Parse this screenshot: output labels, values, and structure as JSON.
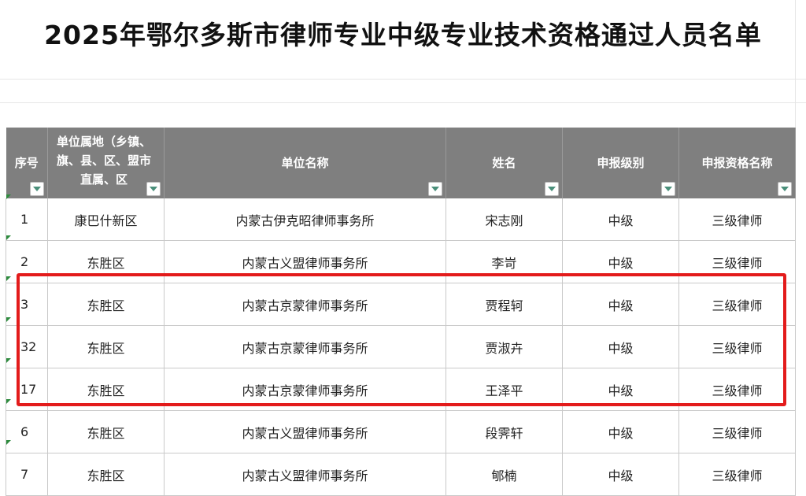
{
  "title": "2025年鄂尔多斯市律师专业中级专业技术资格通过人员名单",
  "table": {
    "headers": [
      {
        "label": "序号"
      },
      {
        "label": "单位属地（乡镇、旗、县、区、盟市直属、区"
      },
      {
        "label": "单位名称"
      },
      {
        "label": "姓名"
      },
      {
        "label": "申报级别"
      },
      {
        "label": "申报资格名称"
      }
    ],
    "rows": [
      {
        "no": "1",
        "region": "康巴什新区",
        "unit": "内蒙古伊克昭律师事务所",
        "name": "宋志刚",
        "level": "中级",
        "qual": "三级律师"
      },
      {
        "no": "2",
        "region": "东胜区",
        "unit": "内蒙古义盟律师事务所",
        "name": "李岢",
        "level": "中级",
        "qual": "三级律师"
      },
      {
        "no": "3",
        "region": "东胜区",
        "unit": "内蒙古京蒙律师事务所",
        "name": "贾程轲",
        "level": "中级",
        "qual": "三级律师"
      },
      {
        "no": "32",
        "region": "东胜区",
        "unit": "内蒙古京蒙律师事务所",
        "name": "贾淑卉",
        "level": "中级",
        "qual": "三级律师"
      },
      {
        "no": "17",
        "region": "东胜区",
        "unit": "内蒙古京蒙律师事务所",
        "name": "王泽平",
        "level": "中级",
        "qual": "三级律师"
      },
      {
        "no": "6",
        "region": "东胜区",
        "unit": "内蒙古义盟律师事务所",
        "name": "段霁轩",
        "level": "中级",
        "qual": "三级律师"
      },
      {
        "no": "7",
        "region": "东胜区",
        "unit": "内蒙古义盟律师事务所",
        "name": "郇楠",
        "level": "中级",
        "qual": "三级律师"
      }
    ]
  },
  "colors": {
    "header_bg": "#7f7f7f",
    "highlight": "#e31b1b",
    "filter_arrow": "#4a8f7a"
  },
  "icons": {
    "filter": "filter-dropdown-icon"
  }
}
